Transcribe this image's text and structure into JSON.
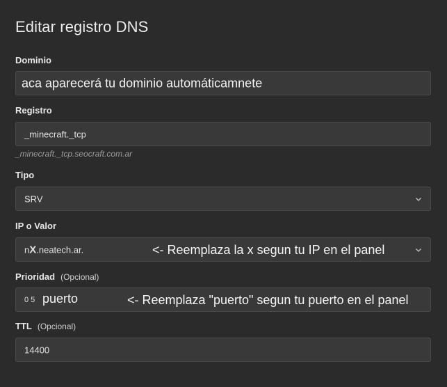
{
  "page": {
    "title": "Editar registro DNS"
  },
  "dominio": {
    "label": "Dominio",
    "value": "aca aparecerá tu dominio automáticamnete"
  },
  "registro": {
    "label": "Registro",
    "value": "_minecraft._tcp",
    "hint": "_minecraft._tcp.seocraft.com.ar"
  },
  "tipo": {
    "label": "Tipo",
    "value": "SRV"
  },
  "ip": {
    "label": "IP o Valor",
    "value_prefix": "n",
    "value_x": "X",
    "value_suffix": ".neatech.ar.",
    "annotation": "<- Reemplaza la x segun tu IP en el panel"
  },
  "prioridad": {
    "label": "Prioridad",
    "optional": "(Opcional)",
    "value": "0 5",
    "overlay": "puerto",
    "annotation": "<- Reemplaza \"puerto\" segun tu puerto en el panel"
  },
  "ttl": {
    "label": "TTL",
    "optional": "(Opcional)",
    "value": "14400"
  },
  "icons": {
    "dropdown": "chevron-down-icon"
  }
}
